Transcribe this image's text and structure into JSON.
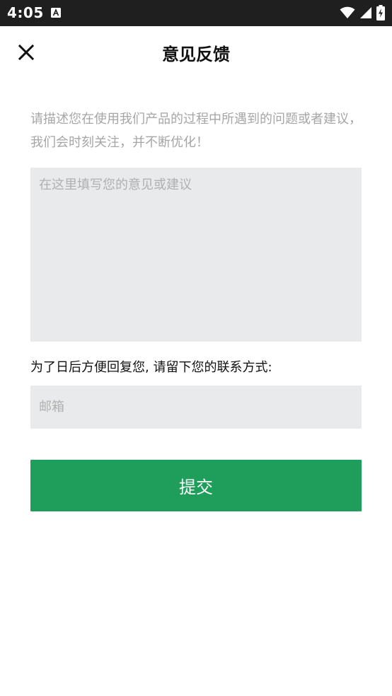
{
  "status_bar": {
    "time": "4:05",
    "icons": [
      "notification-a-icon",
      "wifi-icon",
      "cell-signal-icon",
      "battery-charging-icon"
    ]
  },
  "header": {
    "title": "意见反馈",
    "close_icon": "close-icon"
  },
  "form": {
    "intro": "请描述您在使用我们产品的过程中所遇到的问题或者建议，我们会时刻关注，并不断优化！",
    "feedback_placeholder": "在这里填写您的意见或建议",
    "feedback_value": "",
    "contact_label": "为了日后方便回复您, 请留下您的联系方式:",
    "email_placeholder": "邮箱",
    "email_value": "",
    "submit_label": "提交"
  },
  "colors": {
    "status_bar_bg": "#1f1f1f",
    "accent_green": "#1e9e5a",
    "input_bg": "#e9eaec",
    "hint_text": "#a6a6a6"
  }
}
